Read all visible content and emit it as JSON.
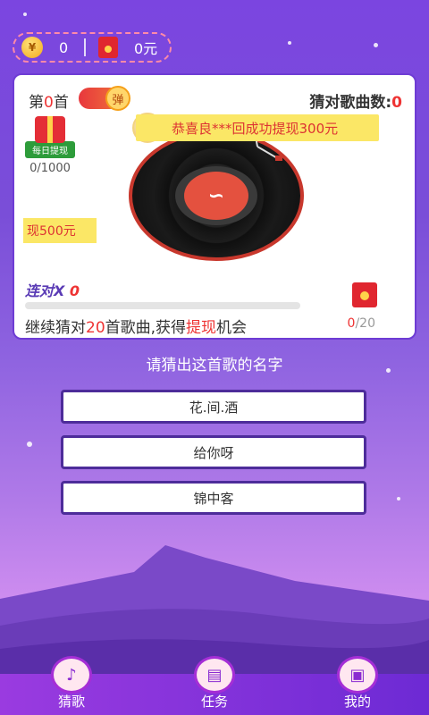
{
  "status": {
    "coin_icon": "coin-icon",
    "coins": "0",
    "cash": "0元"
  },
  "game": {
    "round_prefix": "第",
    "round_num": "0",
    "round_suffix": "首",
    "toggle_label": "弹",
    "correct_label": "猜对歌曲数:",
    "correct_count": "0",
    "daily_label": "每日提现",
    "daily_progress": "0/1000",
    "toast": "恭喜良***回成功提现300元",
    "cash_tag": "现500元",
    "streak_label": "连对X",
    "streak_count": "0",
    "tip_a": "继续猜对",
    "tip_num": "20",
    "tip_b": "首歌曲,获得",
    "tip_red": "提现",
    "tip_c": "机会",
    "reward_done": "0",
    "reward_total": "/20"
  },
  "question": "请猜出这首歌的名字",
  "options": [
    "花.间.酒",
    "给你呀",
    "锦中客"
  ],
  "nav": [
    {
      "label": "猜歌",
      "icon": "music-note-icon"
    },
    {
      "label": "任务",
      "icon": "task-icon"
    },
    {
      "label": "我的",
      "icon": "wallet-icon"
    }
  ]
}
